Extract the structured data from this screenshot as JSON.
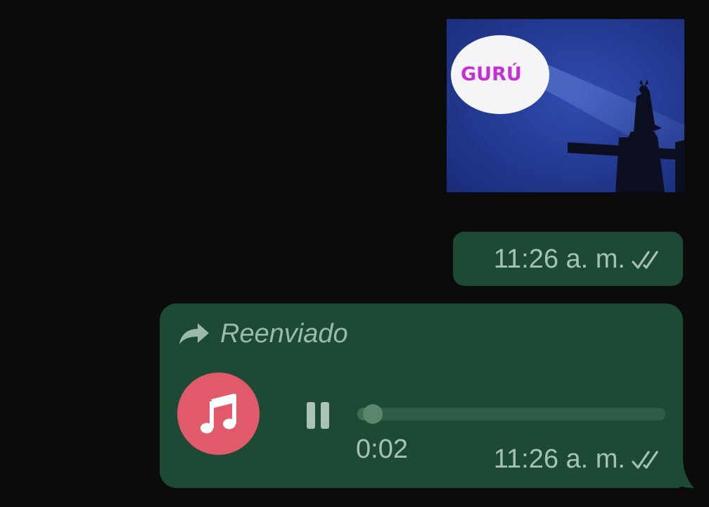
{
  "image_message": {
    "overlay_text": "GURÚ"
  },
  "time_message": {
    "timestamp": "11:26 a. m.",
    "status_icon": "double-check-icon"
  },
  "audio_message": {
    "forwarded_icon": "forward-arrow-icon",
    "forwarded_label": "Reenviado",
    "avatar_icon": "music-note-icon",
    "play_state_icon": "pause-icon",
    "progress": 0.02,
    "duration": "0:02",
    "timestamp": "11:26 a. m.",
    "status_icon": "double-check-icon"
  },
  "colors": {
    "background": "#0b0b0c",
    "bubble": "#1d4a35",
    "meta_text": "#a6c2b3",
    "avatar": "#e15a6a"
  }
}
